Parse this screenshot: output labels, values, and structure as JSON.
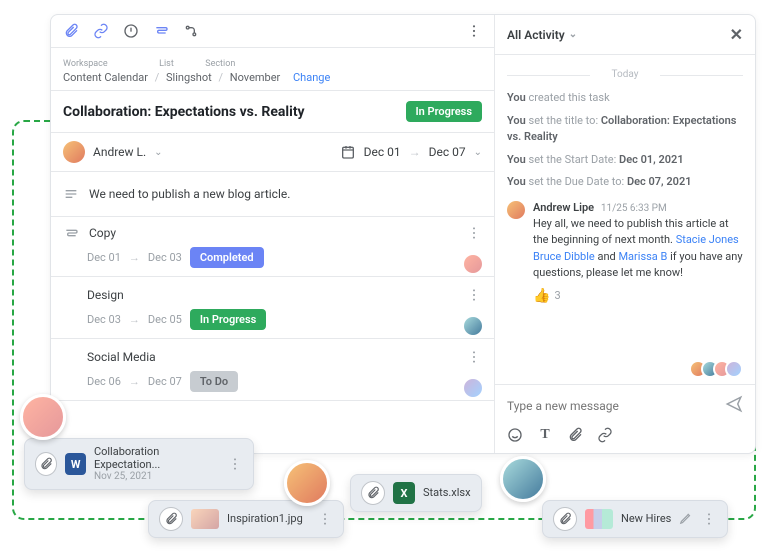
{
  "toolbar": {},
  "activity_header": {
    "title": "All Activity"
  },
  "breadcrumb": {
    "labels": {
      "workspace": "Workspace",
      "list": "List",
      "section": "Section"
    },
    "workspace": "Content Calendar",
    "list": "Slingshot",
    "section": "November",
    "change": "Change"
  },
  "task": {
    "title": "Collaboration: Expectations vs. Reality",
    "status": "In Progress",
    "assignee": "Andrew L.",
    "date_start": "Dec 01",
    "date_end": "Dec 07",
    "description": "We need to publish a new blog article."
  },
  "subtasks": [
    {
      "name": "Copy",
      "start": "Dec 01",
      "end": "Dec 03",
      "status": "Completed",
      "status_class": "bg-blue"
    },
    {
      "name": "Design",
      "start": "Dec 03",
      "end": "Dec 05",
      "status": "In Progress",
      "status_class": "bg-green"
    },
    {
      "name": "Social Media",
      "start": "Dec 06",
      "end": "Dec 07",
      "status": "To Do",
      "status_class": "bg-grey"
    }
  ],
  "activity": {
    "divider": "Today",
    "lines": [
      {
        "prefix": "You ",
        "action": "created this task",
        "value": ""
      },
      {
        "prefix": "You ",
        "action": "set the title to: ",
        "value": "Collaboration: Expectations vs. Reality"
      },
      {
        "prefix": "You ",
        "action": "set the Start Date: ",
        "value": "Dec 01, 2021"
      },
      {
        "prefix": "You ",
        "action": "set the Due Date to: ",
        "value": "Dec 07, 2021"
      }
    ],
    "message": {
      "author": "Andrew Lipe",
      "time": "11/25 6:33 PM",
      "text_pre": "Hey all, we need to publish this article at the beginning of next month. ",
      "mention1": "Stacie Jones",
      "mention2": "Bruce Dibble",
      "mid": " and ",
      "mention3": "Marissa B",
      "text_post": " if you have any questions, please let me know!",
      "reaction_count": "3"
    }
  },
  "composer": {
    "placeholder": "Type a new message"
  },
  "attachments": {
    "a1": {
      "name": "Collaboration Expectation...",
      "date": "Nov 25, 2021"
    },
    "a2": {
      "name": "Inspiration1.jpg"
    },
    "a3": {
      "name": "Stats.xlsx"
    },
    "a4": {
      "name": "New Hires"
    }
  }
}
